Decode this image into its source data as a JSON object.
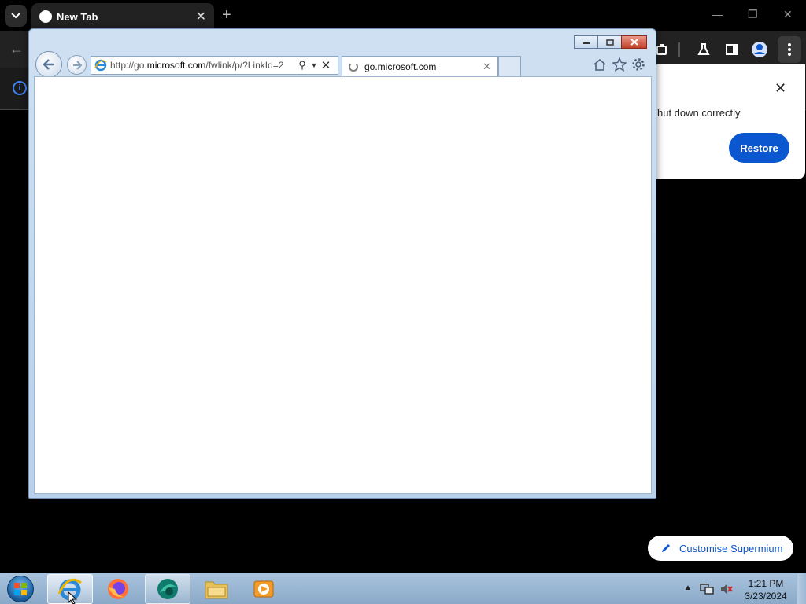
{
  "chrome": {
    "tab_title": "New Tab",
    "restore_popup": {
      "message": "hut down correctly.",
      "restore_label": "Restore"
    },
    "customise_label": "Customise Supermium"
  },
  "ie": {
    "address_prefix": "http://go.",
    "address_domain": "microsoft.com",
    "address_suffix": "/fwlink/p/?LinkId=2",
    "tab_title": "go.microsoft.com"
  },
  "taskbar": {
    "time": "1:21 PM",
    "date": "3/23/2024",
    "pinned_icons": [
      "internet-explorer-icon",
      "firefox-icon",
      "edge-icon",
      "file-explorer-icon",
      "media-player-icon"
    ]
  }
}
